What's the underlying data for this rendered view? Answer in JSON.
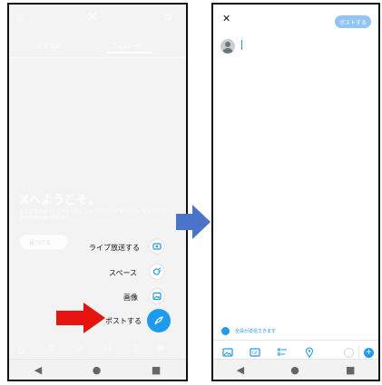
{
  "left_screen": {
    "welcome_title": "Xへようこそ。",
    "welcome_line": "おすすめのポストをチェックしよう。アカウントをフォローすることで最新情報を受け取れます。",
    "find_button": "見つける",
    "tabs": [
      "おすすめ",
      "フォロー中"
    ],
    "menu": [
      {
        "label": "ライブ放送する",
        "icon": "live-broadcast-icon"
      },
      {
        "label": "スペース",
        "icon": "spaces-icon"
      },
      {
        "label": "画像",
        "icon": "image-icon"
      },
      {
        "label": "ポストする",
        "icon": "compose-feather-icon"
      }
    ]
  },
  "right_screen": {
    "post_button": "ポストする",
    "reply_setting": "全員が返信できます"
  },
  "colors": {
    "accent": "#1d9bf0",
    "arrow_red": "#e6130e",
    "arrow_blue": "#4a74c9"
  }
}
